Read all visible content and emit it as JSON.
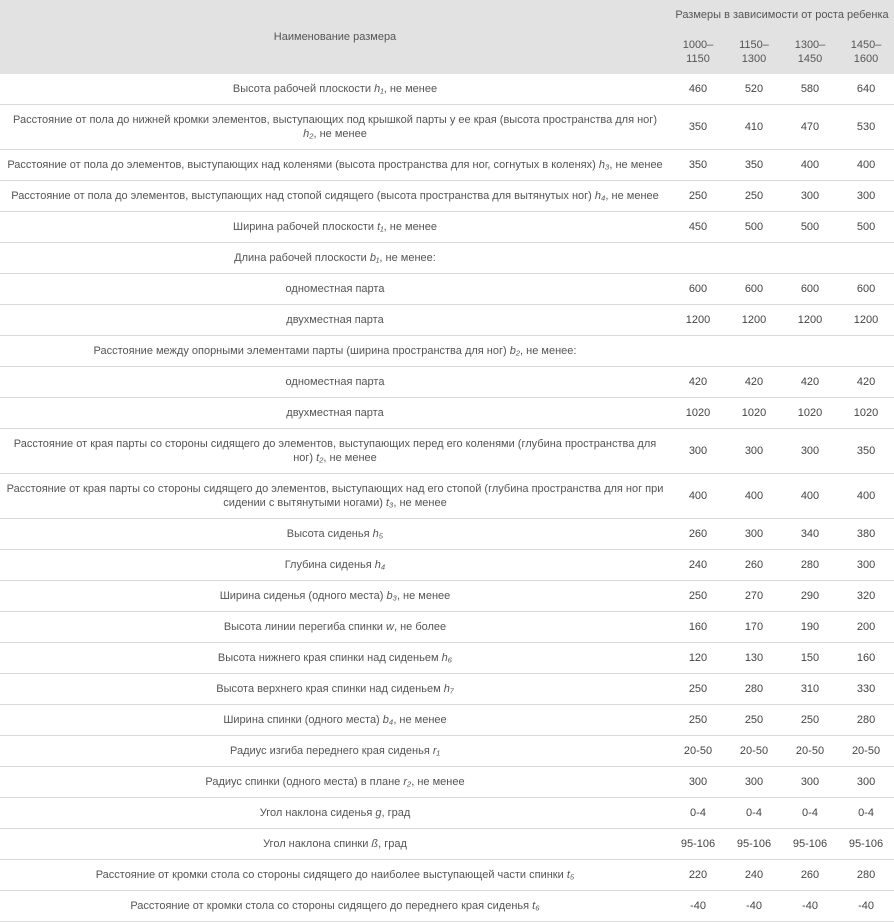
{
  "header": {
    "name_col": "Наименование размера",
    "group": "Размеры в зависимости от роста ребенка",
    "sizes": [
      "1000–1150",
      "1150–1300",
      "1300–1450",
      "1450–1600"
    ]
  },
  "rows": [
    {
      "label": "Высота рабочей плоскости h₁, не менее",
      "v": [
        "460",
        "520",
        "580",
        "640"
      ]
    },
    {
      "label": "Расстояние от пола до нижней кромки элементов, выступающих под крышкой парты у ее края (высота пространства для ног) h₂, не менее",
      "v": [
        "350",
        "410",
        "470",
        "530"
      ]
    },
    {
      "label": "Расстояние от пола до элементов, выступающих над коленями (высота пространства для ног, согнутых в коленях) h₃, не менее",
      "v": [
        "350",
        "350",
        "400",
        "400"
      ]
    },
    {
      "label": "Расстояние от пола до элементов, выступающих над стопой сидящего (высота пространства для вытянутых ног) h₄, не менее",
      "v": [
        "250",
        "250",
        "300",
        "300"
      ]
    },
    {
      "label": "Ширина рабочей плоскости t₁, не менее",
      "v": [
        "450",
        "500",
        "500",
        "500"
      ]
    },
    {
      "label": "Длина рабочей плоскости b₁, не менее:",
      "v": [
        "",
        "",
        "",
        ""
      ],
      "section": true
    },
    {
      "label": "одноместная парта",
      "v": [
        "600",
        "600",
        "600",
        "600"
      ]
    },
    {
      "label": "двухместная парта",
      "v": [
        "1200",
        "1200",
        "1200",
        "1200"
      ]
    },
    {
      "label": "Расстояние между опорными элементами парты (ширина пространства для ног) b₂, не менее:",
      "v": [
        "",
        "",
        "",
        ""
      ],
      "section": true
    },
    {
      "label": "одноместная парта",
      "v": [
        "420",
        "420",
        "420",
        "420"
      ]
    },
    {
      "label": "двухместная парта",
      "v": [
        "1020",
        "1020",
        "1020",
        "1020"
      ]
    },
    {
      "label": "Расстояние от края парты со стороны сидящего до элементов, выступающих перед его коленями (глубина пространства для ног) t₂, не менее",
      "v": [
        "300",
        "300",
        "300",
        "350"
      ]
    },
    {
      "label": "Расстояние от края парты со стороны сидящего до элементов, выступающих над его стопой (глубина пространства для ног при сидении с вытянутыми ногами) t₃, не менее",
      "v": [
        "400",
        "400",
        "400",
        "400"
      ]
    },
    {
      "label": "Высота сиденья h₅",
      "v": [
        "260",
        "300",
        "340",
        "380"
      ]
    },
    {
      "label": "Глубина сиденья h₄",
      "v": [
        "240",
        "260",
        "280",
        "300"
      ]
    },
    {
      "label": "Ширина сиденья (одного места) b₃, не менее",
      "v": [
        "250",
        "270",
        "290",
        "320"
      ]
    },
    {
      "label": "Высота линии перегиба спинки w, не более",
      "v": [
        "160",
        "170",
        "190",
        "200"
      ]
    },
    {
      "label": "Высота нижнего края спинки над сиденьем h₆",
      "v": [
        "120",
        "130",
        "150",
        "160"
      ]
    },
    {
      "label": "Высота верхнего края спинки над сиденьем h₇",
      "v": [
        "250",
        "280",
        "310",
        "330"
      ]
    },
    {
      "label": "Ширина спинки (одного места) b₄, не менее",
      "v": [
        "250",
        "250",
        "250",
        "280"
      ]
    },
    {
      "label": "Радиус изгиба переднего края сиденья r₁",
      "v": [
        "20-50",
        "20-50",
        "20-50",
        "20-50"
      ]
    },
    {
      "label": "Радиус спинки (одного места) в плане r₂, не менее",
      "v": [
        "300",
        "300",
        "300",
        "300"
      ]
    },
    {
      "label": "Угол наклона сиденья g, град",
      "v": [
        "0-4",
        "0-4",
        "0-4",
        "0-4"
      ]
    },
    {
      "label": "Угол наклона спинки ß, град",
      "v": [
        "95-106",
        "95-106",
        "95-106",
        "95-106"
      ]
    },
    {
      "label": "Расстояние от кромки стола со стороны сидящего до наиболее выступающей части спинки t₅",
      "v": [
        "220",
        "240",
        "260",
        "280"
      ]
    },
    {
      "label": "Расстояние от кромки стола со стороны сидящего до переднего края сиденья t₆",
      "v": [
        "-40",
        "-40",
        "-40",
        "-40"
      ]
    }
  ]
}
